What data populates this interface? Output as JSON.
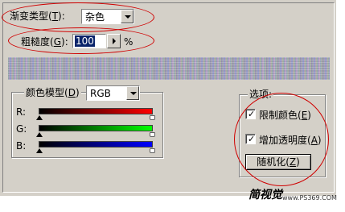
{
  "dialog": {
    "gradient_type": {
      "label": "渐变类型",
      "accel": "T",
      "value": "杂色"
    },
    "roughness": {
      "label": "粗糙度",
      "accel": "G",
      "value": "100",
      "unit": "%"
    },
    "color_model": {
      "label": "颜色模型",
      "accel": "D",
      "value": "RGB",
      "channels": [
        {
          "label": "R:",
          "gradient_end": "#ff0000"
        },
        {
          "label": "G:",
          "gradient_end": "#00ff00"
        },
        {
          "label": "B:",
          "gradient_end": "#0000ff"
        }
      ]
    },
    "options": {
      "title": "选项:",
      "restrict_colors": {
        "label": "限制颜色",
        "accel": "E",
        "checked": true
      },
      "add_transparency": {
        "label": "增加透明度",
        "accel": "A",
        "checked": true
      },
      "randomize": {
        "label": "随机化",
        "accel": "Z"
      }
    }
  },
  "annotation_color": "#d00000",
  "watermark": {
    "logo": "简视觉",
    "url": "www.PS369.COM"
  }
}
